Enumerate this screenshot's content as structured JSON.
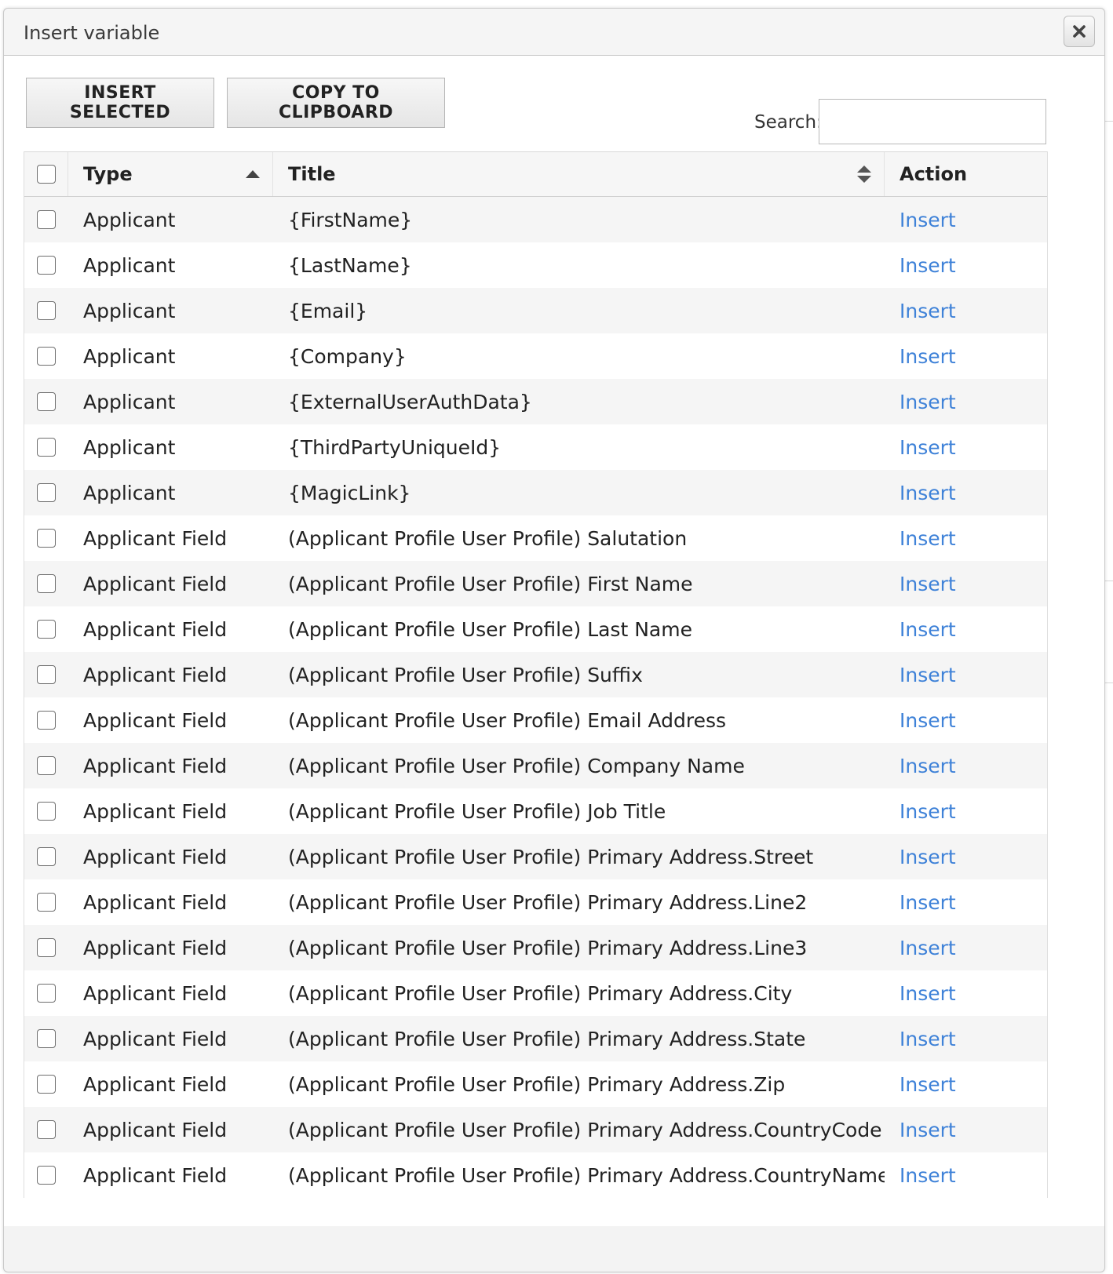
{
  "dialog": {
    "title": "Insert variable",
    "close_icon": "close-icon"
  },
  "toolbar": {
    "insert_selected_label": "INSERT SELECTED",
    "copy_label": "COPY TO CLIPBOARD",
    "search_label": "Search:",
    "search_value": ""
  },
  "table": {
    "headers": {
      "type": "Type",
      "title": "Title",
      "action": "Action"
    },
    "sort": {
      "type": "ascending",
      "title": "unsorted"
    },
    "rows": [
      {
        "type": "Applicant",
        "title": "{FirstName}",
        "action": "Insert"
      },
      {
        "type": "Applicant",
        "title": "{LastName}",
        "action": "Insert"
      },
      {
        "type": "Applicant",
        "title": "{Email}",
        "action": "Insert"
      },
      {
        "type": "Applicant",
        "title": "{Company}",
        "action": "Insert"
      },
      {
        "type": "Applicant",
        "title": "{ExternalUserAuthData}",
        "action": "Insert"
      },
      {
        "type": "Applicant",
        "title": "{ThirdPartyUniqueId}",
        "action": "Insert"
      },
      {
        "type": "Applicant",
        "title": "{MagicLink}",
        "action": "Insert"
      },
      {
        "type": "Applicant Field",
        "title": "(Applicant Profile User Profile) Salutation",
        "action": "Insert"
      },
      {
        "type": "Applicant Field",
        "title": "(Applicant Profile User Profile) First Name",
        "action": "Insert"
      },
      {
        "type": "Applicant Field",
        "title": "(Applicant Profile User Profile) Last Name",
        "action": "Insert"
      },
      {
        "type": "Applicant Field",
        "title": "(Applicant Profile User Profile) Suffix",
        "action": "Insert"
      },
      {
        "type": "Applicant Field",
        "title": "(Applicant Profile User Profile) Email Address",
        "action": "Insert"
      },
      {
        "type": "Applicant Field",
        "title": "(Applicant Profile User Profile) Company Name",
        "action": "Insert"
      },
      {
        "type": "Applicant Field",
        "title": "(Applicant Profile User Profile) Job Title",
        "action": "Insert"
      },
      {
        "type": "Applicant Field",
        "title": "(Applicant Profile User Profile) Primary Address.Street",
        "action": "Insert"
      },
      {
        "type": "Applicant Field",
        "title": "(Applicant Profile User Profile) Primary Address.Line2",
        "action": "Insert"
      },
      {
        "type": "Applicant Field",
        "title": "(Applicant Profile User Profile) Primary Address.Line3",
        "action": "Insert"
      },
      {
        "type": "Applicant Field",
        "title": "(Applicant Profile User Profile) Primary Address.City",
        "action": "Insert"
      },
      {
        "type": "Applicant Field",
        "title": "(Applicant Profile User Profile) Primary Address.State",
        "action": "Insert"
      },
      {
        "type": "Applicant Field",
        "title": "(Applicant Profile User Profile) Primary Address.Zip",
        "action": "Insert"
      },
      {
        "type": "Applicant Field",
        "title": "(Applicant Profile User Profile) Primary Address.CountryCode",
        "action": "Insert"
      },
      {
        "type": "Applicant Field",
        "title": "(Applicant Profile User Profile) Primary Address.CountryName",
        "action": "Insert"
      }
    ]
  },
  "colors": {
    "link": "#3f82d8",
    "row_alt": "#f5f5f5",
    "header_bg": "#f6f6f6"
  }
}
